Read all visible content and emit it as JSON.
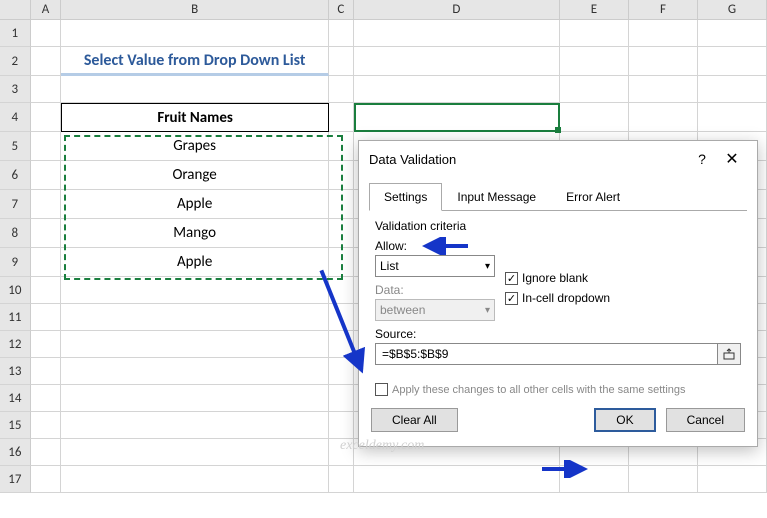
{
  "columns": [
    "A",
    "B",
    "C",
    "D",
    "E",
    "F",
    "G"
  ],
  "rows_labels": [
    "1",
    "2",
    "3",
    "4",
    "5",
    "6",
    "7",
    "8",
    "9",
    "10",
    "11",
    "12",
    "13",
    "14",
    "15",
    "16",
    "17"
  ],
  "sheet": {
    "title": "Select Value from Drop Down List",
    "header": "Fruit Names",
    "data": [
      "Grapes",
      "Orange",
      "Apple",
      "Mango",
      "Apple"
    ]
  },
  "dialog": {
    "title": "Data Validation",
    "tabs": {
      "settings": "Settings",
      "input": "Input Message",
      "error": "Error Alert"
    },
    "criteria_label": "Validation criteria",
    "allow_label": "Allow:",
    "allow_value": "List",
    "data_label": "Data:",
    "data_value": "between",
    "source_label": "Source:",
    "source_value": "=$B$5:$B$9",
    "ignore_blank": "Ignore blank",
    "incell": "In-cell dropdown",
    "apply_all": "Apply these changes to all other cells with the same settings",
    "buttons": {
      "clear": "Clear All",
      "ok": "OK",
      "cancel": "Cancel"
    }
  },
  "watermark": "exceldemy.com"
}
